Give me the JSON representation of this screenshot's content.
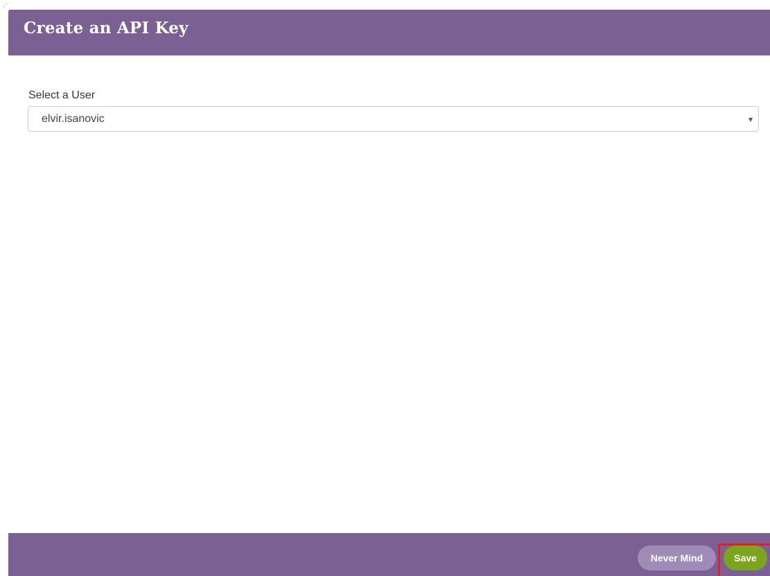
{
  "dialog": {
    "title": "Create an API Key"
  },
  "form": {
    "user_label": "Select a User",
    "user_select": {
      "selected_value": "elvir.isanovic"
    }
  },
  "footer": {
    "never_mind_label": "Never Mind",
    "save_label": "Save"
  },
  "colors": {
    "header_bg": "#7b6193",
    "never_mind_bg": "#9f8bb5",
    "save_bg": "#7aa51d",
    "highlight": "#e0202a"
  },
  "icons": {
    "select_arrow": "chevron-down-icon"
  }
}
